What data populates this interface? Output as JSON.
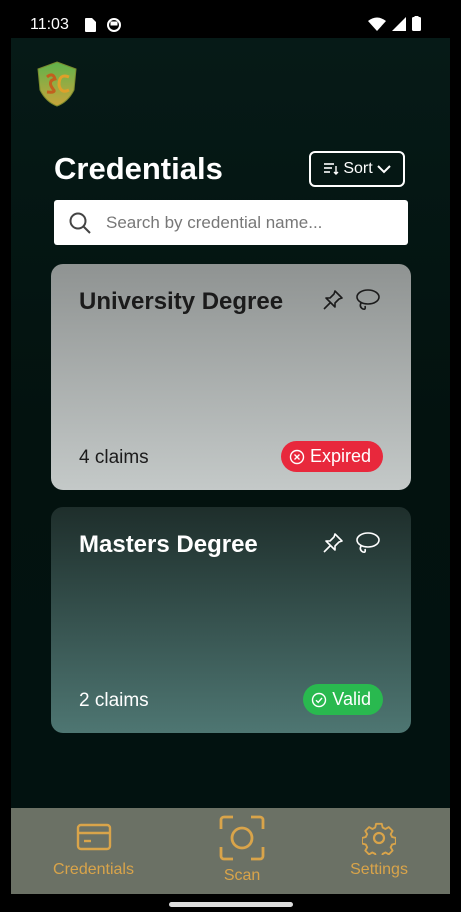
{
  "status_bar": {
    "time": "11:03"
  },
  "header": {
    "title": "Credentials",
    "sort_label": "Sort",
    "search_placeholder": "Search by credential name..."
  },
  "credentials": [
    {
      "name": "University Degree",
      "claims": "4 claims",
      "status": "Expired"
    },
    {
      "name": "Masters Degree",
      "claims": "2 claims",
      "status": "Valid"
    }
  ],
  "bottom_nav": [
    {
      "label": "Credentials",
      "icon": "card-icon"
    },
    {
      "label": "Scan",
      "icon": "scan-icon"
    },
    {
      "label": "Settings",
      "icon": "gear-icon"
    }
  ],
  "colors": {
    "accent": "#d9a44a",
    "expired": "#e8283c",
    "valid": "#29b94f",
    "nav_bg": "#6b7165"
  }
}
